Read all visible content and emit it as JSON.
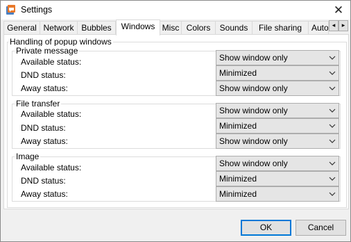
{
  "window": {
    "title": "Settings",
    "close_glyph": "✕"
  },
  "tabs": [
    {
      "label": "General"
    },
    {
      "label": "Network"
    },
    {
      "label": "Bubbles"
    },
    {
      "label": "Windows",
      "active": true
    },
    {
      "label": "Misc"
    },
    {
      "label": "Colors"
    },
    {
      "label": "Sounds"
    },
    {
      "label": "File sharing"
    },
    {
      "label": "Auto"
    }
  ],
  "tab_scroll": {
    "left": "◂",
    "right": "▸"
  },
  "panel": {
    "outer_title": "Handling of popup windows",
    "groups": [
      {
        "title": "Private message",
        "rows": [
          {
            "label": "Available status:",
            "value": "Show window only"
          },
          {
            "label": "DND status:",
            "value": "Minimized"
          },
          {
            "label": "Away status:",
            "value": "Show window only"
          }
        ]
      },
      {
        "title": "File transfer",
        "rows": [
          {
            "label": "Available status:",
            "value": "Show window only"
          },
          {
            "label": "DND status:",
            "value": "Minimized"
          },
          {
            "label": "Away status:",
            "value": "Show window only"
          }
        ]
      },
      {
        "title": "Image",
        "rows": [
          {
            "label": "Available status:",
            "value": "Show window only"
          },
          {
            "label": "DND status:",
            "value": "Minimized"
          },
          {
            "label": "Away status:",
            "value": "Minimized"
          }
        ]
      }
    ]
  },
  "buttons": {
    "ok": "OK",
    "cancel": "Cancel"
  },
  "colors": {
    "focus_accent": "#0078d7",
    "panel_bg": "#ffffff",
    "dialog_bg": "#f0f0f0"
  },
  "icons": {
    "app": "app-logo-icon",
    "close": "close-icon",
    "dropdown": "chevron-down-icon"
  }
}
